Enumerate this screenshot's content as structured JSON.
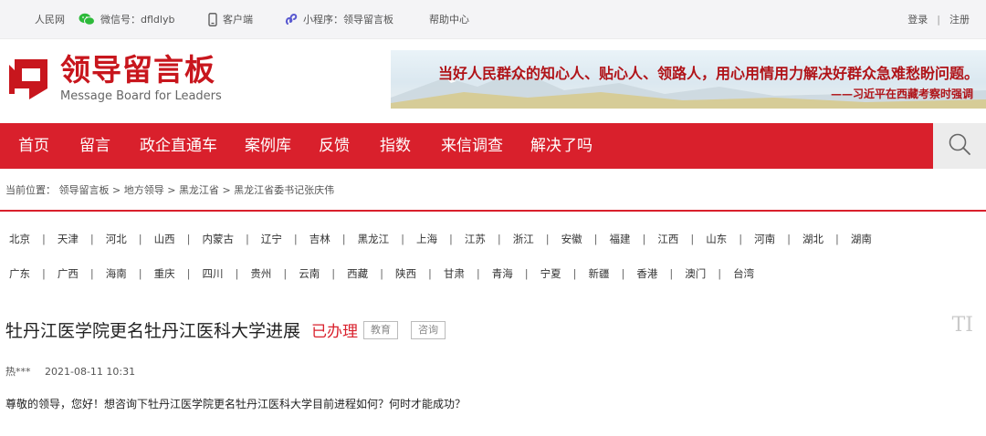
{
  "topbar": {
    "site_name": "人民网",
    "wechat": "微信号：dfldlyb",
    "client": "客户端",
    "mini_program": "小程序：领导留言板",
    "help": "帮助中心",
    "login": "登录",
    "divider": "|",
    "register": "注册"
  },
  "logo": {
    "name_cn": "领导留言板",
    "name_en": "Message Board for Leaders"
  },
  "banner": {
    "quote": "当好人民群众的知心人、贴心人、领路人，用心用情用力解决好群众急难愁盼问题。",
    "source": "——习近平在西藏考察时强调"
  },
  "nav": {
    "items": [
      "首页",
      "留言",
      "政企直通车",
      "案例库",
      "反馈",
      "指数",
      "来信调查",
      "解决了吗"
    ]
  },
  "breadcrumb": {
    "prefix": "当前位置：",
    "items": [
      "领导留言板",
      "地方领导",
      "黑龙江省",
      "黑龙江省委书记张庆伟"
    ],
    "separator": ">"
  },
  "regions": {
    "row1": [
      "北京",
      "天津",
      "河北",
      "山西",
      "内蒙古",
      "辽宁",
      "吉林",
      "黑龙江",
      "上海",
      "江苏",
      "浙江",
      "安徽",
      "福建",
      "江西",
      "山东",
      "河南",
      "湖北",
      "湖南"
    ],
    "row2": [
      "广东",
      "广西",
      "海南",
      "重庆",
      "四川",
      "贵州",
      "云南",
      "西藏",
      "陕西",
      "甘肃",
      "青海",
      "宁夏",
      "新疆",
      "香港",
      "澳门",
      "台湾"
    ]
  },
  "article": {
    "title": "牡丹江医学院更名牡丹江医科大学进展",
    "status": "已办理",
    "tags": [
      "教育",
      "咨询"
    ],
    "font_toggle": "TI",
    "author": "热***",
    "date": "2021-08-11 10:31",
    "content": "尊敬的领导，您好！想咨询下牡丹江医学院更名牡丹江医科大学目前进程如何？何时才能成功？"
  },
  "colors": {
    "brand_red": "#d9202c",
    "logo_red": "#c8161d",
    "topbar_bg": "#f4f4f6",
    "wechat_green": "#2dba3a",
    "miniprogram_blue": "#5a5ad0"
  },
  "icons": {
    "wechat": "wechat-icon",
    "client": "phone-icon",
    "mini_program": "mini-program-icon",
    "search": "search-icon",
    "logo": "logo-mark-icon"
  }
}
